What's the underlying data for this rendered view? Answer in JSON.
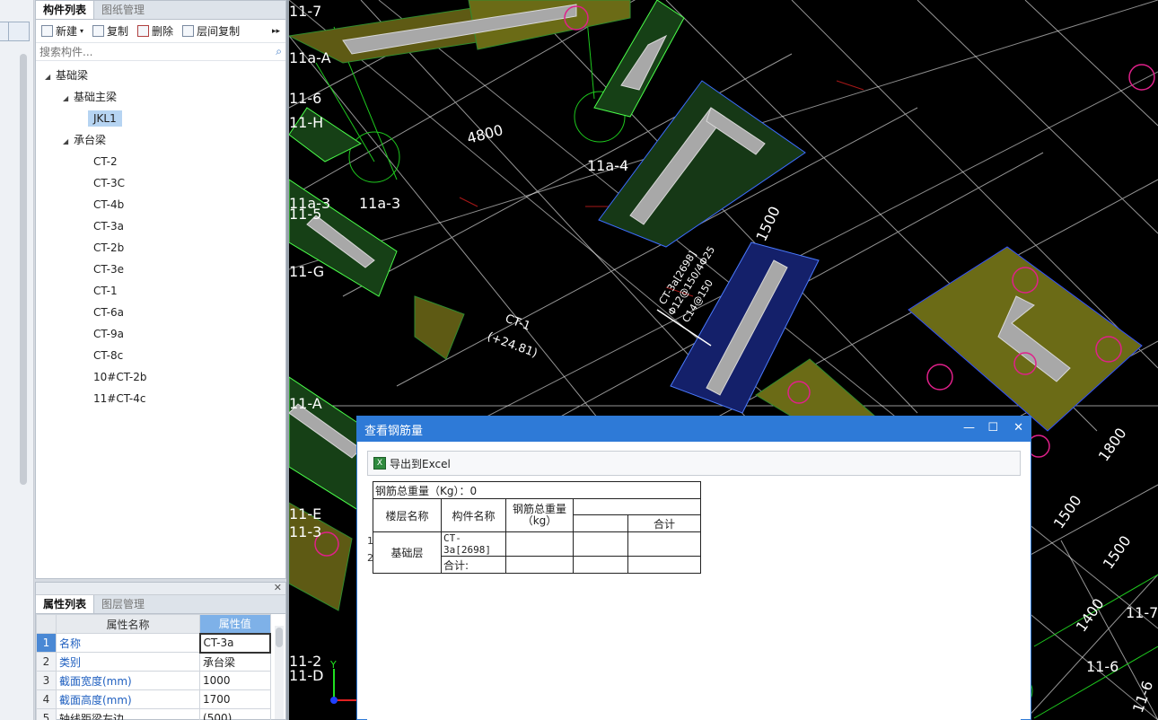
{
  "component_panel": {
    "tabs": [
      "构件列表",
      "图纸管理"
    ],
    "toolbar": {
      "new": "新建",
      "copy": "复制",
      "delete": "删除",
      "floor_copy": "层间复制"
    },
    "search_placeholder": "搜索构件...",
    "tree": {
      "root": "基础梁",
      "groups": [
        {
          "label": "基础主梁",
          "items": [
            "JKL1"
          ]
        },
        {
          "label": "承台梁",
          "items": [
            "CT-2",
            "CT-3C",
            "CT-4b",
            "CT-3a",
            "CT-2b",
            "CT-3e",
            "CT-1",
            "CT-6a",
            "CT-9a",
            "CT-8c",
            "10#CT-2b",
            "11#CT-4c"
          ]
        }
      ],
      "selected": "JKL1"
    }
  },
  "property_panel": {
    "tabs": [
      "属性列表",
      "图层管理"
    ],
    "columns": [
      "属性名称",
      "属性值"
    ],
    "rows": [
      {
        "num": "1",
        "name": "名称",
        "value": "CT-3a"
      },
      {
        "num": "2",
        "name": "类别",
        "value": "承台梁"
      },
      {
        "num": "3",
        "name": "截面宽度(mm)",
        "value": "1000"
      },
      {
        "num": "4",
        "name": "截面高度(mm)",
        "value": "1700"
      },
      {
        "num": "5",
        "name": "轴线距梁左边",
        "value": "(500)"
      }
    ]
  },
  "cad": {
    "labels": [
      "11-7",
      "11a-A",
      "11-6",
      "11-H",
      "11a-3",
      "11a-4",
      "4800",
      "11a-3",
      "11-5",
      "11-G",
      "CT-1",
      "(+24.81)",
      "11-A",
      "11-E",
      "11-3",
      "11-2",
      "11-D",
      "1500",
      "1800",
      "1500",
      "1500",
      "1400",
      "11-7",
      "11-6",
      "11-6"
    ],
    "annotation": [
      "CT-3a[2698]",
      "Φ12@150/4Φ25",
      "C14@150"
    ]
  },
  "dialog": {
    "title": "查看钢筋量",
    "export_label": "导出到Excel",
    "total_weight": "钢筋总重量（Kg）：0",
    "headers": {
      "floor": "楼层名称",
      "component": "构件名称",
      "weight": "钢筋总重量\n（kg）",
      "sum": "合计"
    },
    "rows": [
      {
        "num": "1",
        "floor": "基础层",
        "component": "CT-3a[2698]"
      },
      {
        "num": "2",
        "component": "合计:"
      }
    ]
  }
}
